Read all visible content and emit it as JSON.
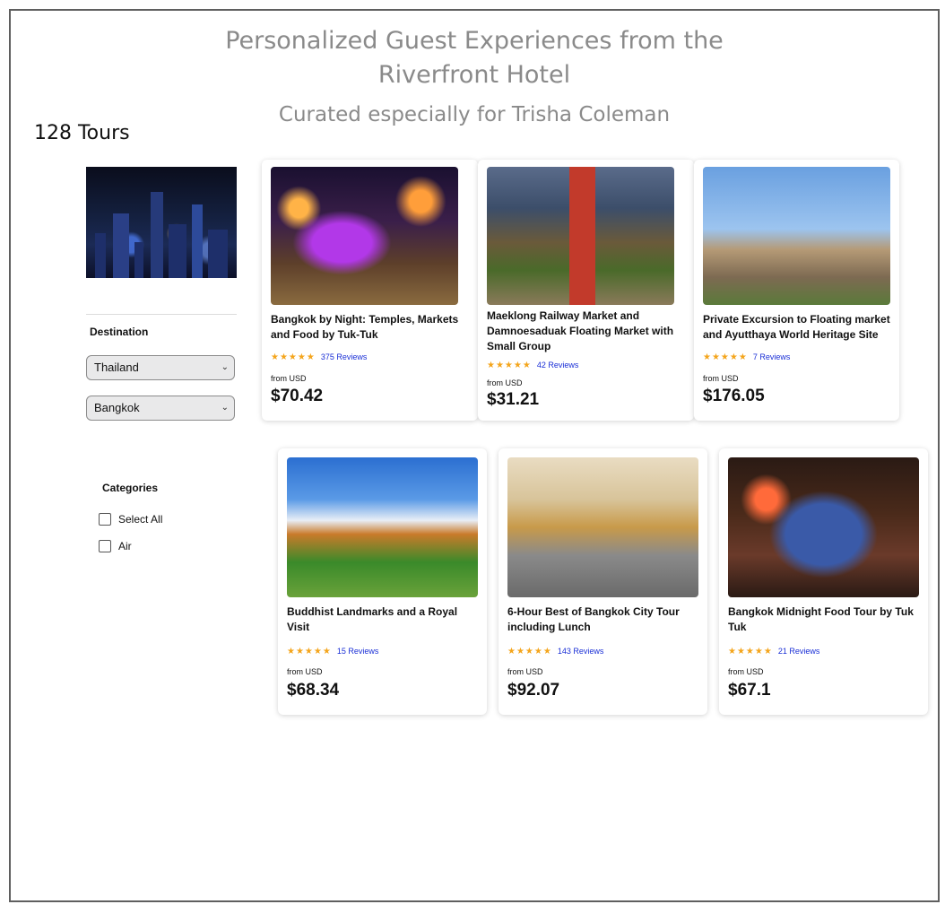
{
  "header": {
    "title_line1": "Personalized Guest Experiences from the",
    "title_line2": "Riverfront Hotel",
    "subtitle": "Curated especially for Trisha Coleman"
  },
  "tour_count": "128 Tours",
  "sidebar": {
    "destination_label": "Destination",
    "country_select": "Thailand",
    "city_select": "Bangkok",
    "categories_label": "Categories",
    "categories": [
      {
        "label": "Select All",
        "checked": false
      },
      {
        "label": "Air",
        "checked": false
      }
    ]
  },
  "tours": [
    {
      "title": "Bangkok by Night: Temples, Markets and Food by Tuk-Tuk",
      "stars": "★★★★★",
      "reviews": "375 Reviews",
      "from": "from USD",
      "price": "$70.42",
      "image_icon": "tuk-tuk-night-photo"
    },
    {
      "title": "Maeklong Railway Market and Damnoesaduak Floating Market with Small Group",
      "stars": "★★★★★",
      "reviews": "42 Reviews",
      "from": "from USD",
      "price": "$31.21",
      "image_icon": "railway-market-photo"
    },
    {
      "title": "Private Excursion to Floating market and Ayutthaya World Heritage Site",
      "stars": "★★★★★",
      "reviews": "7 Reviews",
      "from": "from USD",
      "price": "$176.05",
      "image_icon": "ayutthaya-temple-photo"
    },
    {
      "title": "Buddhist Landmarks and a Royal Visit",
      "stars": "★★★★★",
      "reviews": "15 Reviews",
      "from": "from USD",
      "price": "$68.34",
      "image_icon": "buddhist-temple-photo"
    },
    {
      "title": "6-Hour Best of Bangkok City Tour including Lunch",
      "stars": "★★★★★",
      "reviews": "143 Reviews",
      "from": "from USD",
      "price": "$92.07",
      "image_icon": "grand-palace-photo"
    },
    {
      "title": "Bangkok Midnight Food Tour by Tuk Tuk",
      "stars": "★★★★★",
      "reviews": "21 Reviews",
      "from": "from USD",
      "price": "$67.1",
      "image_icon": "tuk-tuk-taxi-photo"
    }
  ],
  "colors": {
    "star": "#f4a51c",
    "reviews_link": "#1a2fd6",
    "header_text": "#8a8a8a"
  }
}
